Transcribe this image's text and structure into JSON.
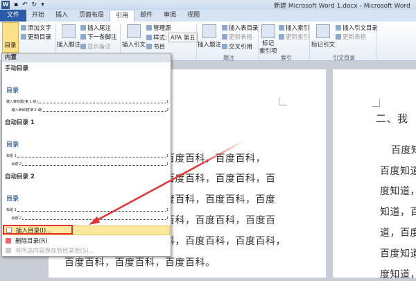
{
  "window": {
    "title": "新建 Microsoft Word 1.docx - Microsoft Word"
  },
  "tabs": [
    "文件",
    "开始",
    "插入",
    "页面布局",
    "引用",
    "邮件",
    "审阅",
    "视图"
  ],
  "ribbon": {
    "toc": {
      "label": "目录",
      "add_text": "添加文字",
      "update_toc": "更新目录"
    },
    "footnotes": {
      "insert_footnote": "插入脚注",
      "insert_endnote": "插入尾注",
      "next_footnote": "下一条脚注",
      "show_notes": "显示备注"
    },
    "citations": {
      "insert_citation": "插入引文",
      "manage_sources": "管理源",
      "style_label": "样式:",
      "style_value": "APA 第五",
      "bibliography": "书目"
    },
    "captions": {
      "insert_caption": "插入题注",
      "insert_table_of_figures": "插入表目录",
      "update_table": "更新表格",
      "cross_reference": "交叉引用",
      "group": "题注"
    },
    "index": {
      "mark_entry": "标记\n索引项",
      "mark_entry_l1": "标记",
      "mark_entry_l2": "索引项",
      "insert_index": "插入索引",
      "update_index": "更新索引",
      "group": "索引"
    },
    "toa": {
      "mark_citation": "标记引文",
      "insert_toa": "插入引文目录",
      "update_table": "更新表格",
      "group": "引文目录"
    }
  },
  "dropdown": {
    "header": "内置",
    "sections": [
      {
        "name": "手动目录",
        "title": "目录",
        "entries": [
          {
            "text": "键入章标题(第 1 级)",
            "page": "1"
          },
          {
            "text": "键入章标题(第 2 级)",
            "page": "2"
          }
        ]
      },
      {
        "name": "自动目录 1",
        "title": "目录",
        "entries": [
          {
            "text": "标题 1",
            "page": "1"
          },
          {
            "text": "标题 2",
            "page": "1"
          }
        ]
      },
      {
        "name": "自动目录 2",
        "title": "目录",
        "entries": [
          {
            "text": "标题 1",
            "page": "1"
          },
          {
            "text": "标题 2",
            "page": "1"
          }
        ]
      }
    ],
    "menu": [
      {
        "label": "插入目录(I)...",
        "state": "highlighted"
      },
      {
        "label": "删除目录(R)",
        "state": "enabled"
      },
      {
        "label": "将所选内容保存到目录库(S)...",
        "state": "disabled"
      }
    ]
  },
  "document": {
    "page1_lines": [
      "百度百科，百度百科，百度百科，百度百科，",
      "百度百科，百度百科，百度百科，百度百科，百",
      "度百科，百度百科，百度百科，百度百科，百度",
      "百科，百度百科，百度百科，百度百科，百度百",
      "科，百度百科，百度百科，百度百科，百度百科，",
      "百度百科，百度百科，百度百科。"
    ],
    "page2_heading": "二、我",
    "page2_lines": [
      "百度知",
      "百度知道",
      "度知道，",
      "知道，百",
      "道，百度",
      "百度知道",
      "度知道，"
    ]
  },
  "colors": {
    "accent": "#2a5aa8",
    "highlight": "#fde8a0",
    "annotation": "#e53333"
  }
}
